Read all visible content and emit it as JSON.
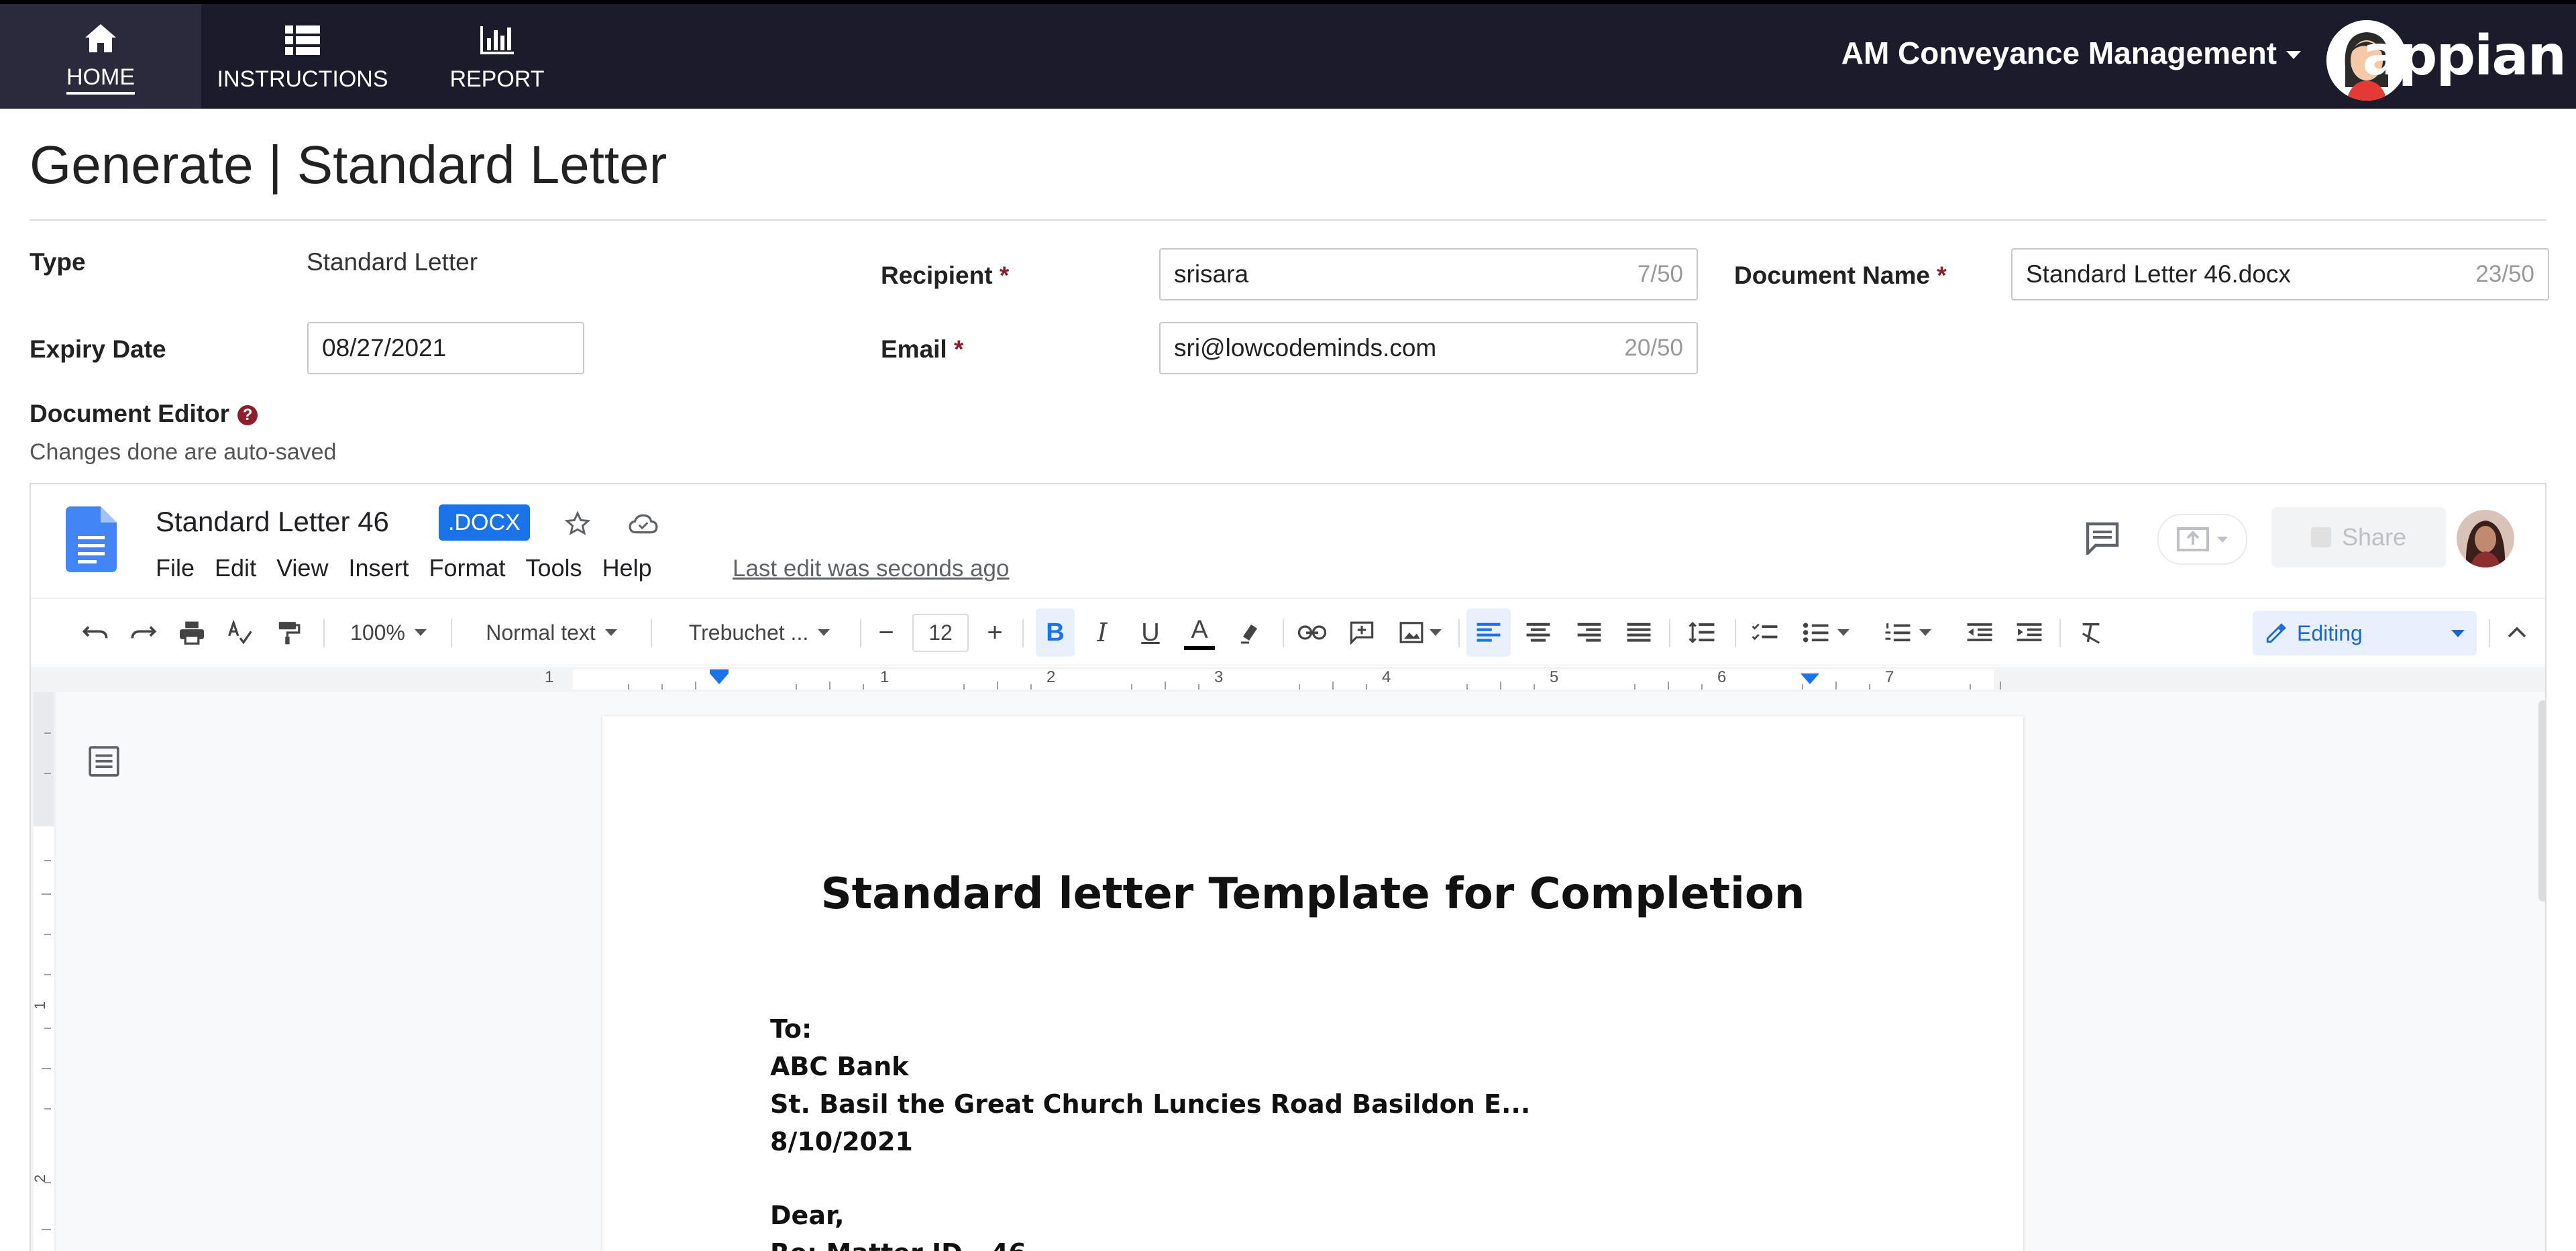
{
  "nav": {
    "items": [
      {
        "label": "HOME",
        "icon": "home-icon",
        "active": true
      },
      {
        "label": "INSTRUCTIONS",
        "icon": "list-icon",
        "active": false
      },
      {
        "label": "REPORT",
        "icon": "bar-chart-icon",
        "active": false
      }
    ],
    "app_name": "AM Conveyance Management",
    "brand": "appian"
  },
  "page": {
    "title": "Generate | Standard Letter"
  },
  "form": {
    "type_label": "Type",
    "type_value": "Standard Letter",
    "expiry_label": "Expiry Date",
    "expiry_value": "08/27/2021",
    "recipient_label": "Recipient",
    "recipient_value": "srisara",
    "recipient_count": "7/50",
    "email_label": "Email",
    "email_value": "sri@lowcodeminds.com",
    "email_count": "20/50",
    "docname_label": "Document Name",
    "docname_value": "Standard Letter 46.docx",
    "docname_count": "23/50",
    "required_mark": "*",
    "editor_label": "Document Editor",
    "editor_help": "?",
    "autosave_note": "Changes done are auto-saved"
  },
  "editor": {
    "doc_title": "Standard Letter 46",
    "format_badge": ".DOCX",
    "menu": [
      "File",
      "Edit",
      "View",
      "Insert",
      "Format",
      "Tools",
      "Help"
    ],
    "last_edit": "Last edit was seconds ago",
    "share_label": "Share",
    "toolbar": {
      "zoom": "100%",
      "style": "Normal text",
      "font": "Trebuchet ...",
      "font_size": "12",
      "minus": "−",
      "plus": "+",
      "mode": "Editing"
    },
    "ruler_numbers": [
      "1",
      "1",
      "2",
      "3",
      "4",
      "5",
      "6",
      "7"
    ],
    "vruler_numbers": [
      "1",
      "2"
    ]
  },
  "letter": {
    "title": "Standard letter Template for Completion",
    "to": "To:",
    "bank": "ABC Bank",
    "address": "St. Basil the Great Church Luncies Road Basildon E...",
    "date": "8/10/2021",
    "greeting": "Dear,",
    "re": "Re: Matter ID - 46"
  },
  "colors": {
    "nav_bg": "#1b1b2b",
    "accent_blue": "#1a73e8",
    "required_red": "#8b1f2c"
  }
}
